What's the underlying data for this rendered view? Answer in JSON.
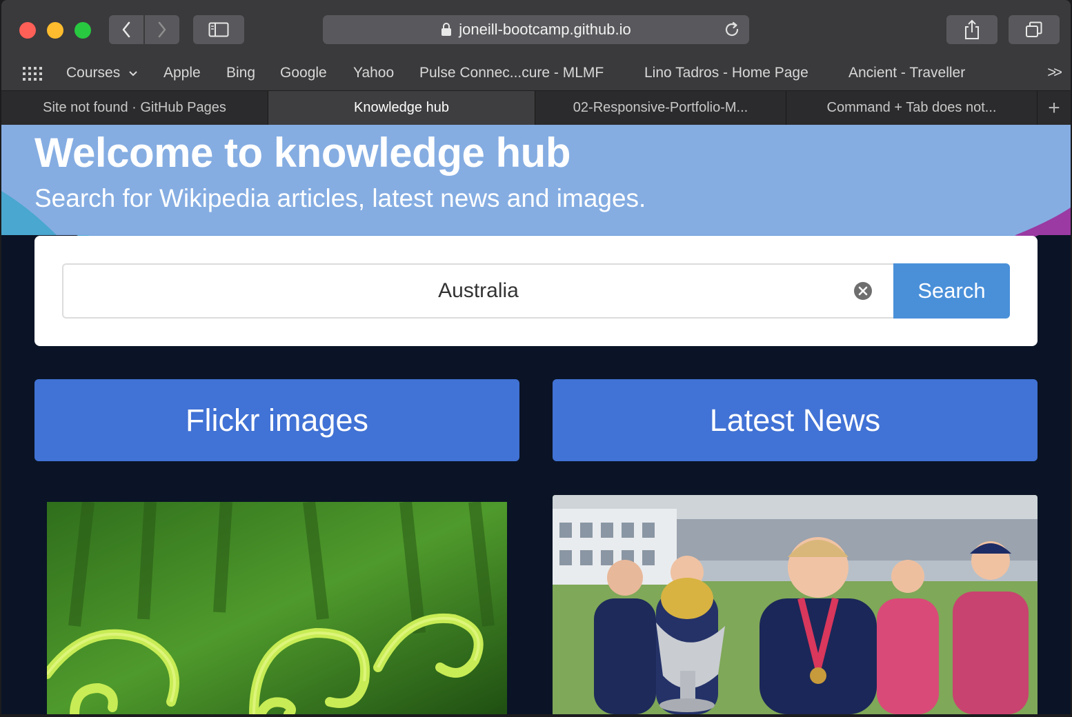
{
  "browser": {
    "address": "joneill-bootcamp.github.io",
    "favorites": [
      {
        "label": "Courses",
        "has_dropdown": true
      },
      {
        "label": "Apple"
      },
      {
        "label": "Bing"
      },
      {
        "label": "Google"
      },
      {
        "label": "Yahoo"
      },
      {
        "label": "Pulse Connec...cure - MLMF"
      },
      {
        "label": "Lino Tadros - Home Page"
      },
      {
        "label": "Ancient - Traveller"
      }
    ],
    "favorites_more": ">>",
    "tabs": [
      {
        "label": "Site not found · GitHub Pages",
        "active": false
      },
      {
        "label": "Knowledge hub",
        "active": true
      },
      {
        "label": "02-Responsive-Portfolio-M...",
        "active": false
      },
      {
        "label": "Command + Tab does not...",
        "active": false
      }
    ],
    "new_tab": "+"
  },
  "hero": {
    "title": "Welcome to knowledge hub",
    "subtitle": "Search for Wikipedia articles, latest news and images."
  },
  "search": {
    "value": "Australia",
    "button_label": "Search"
  },
  "sections": {
    "flickr_label": "Flickr images",
    "news_label": "Latest News"
  },
  "colors": {
    "accent": "#4a90d9",
    "section_button": "#4172d5",
    "hero_band": "#85ade2",
    "page_background": "#0a1426"
  }
}
